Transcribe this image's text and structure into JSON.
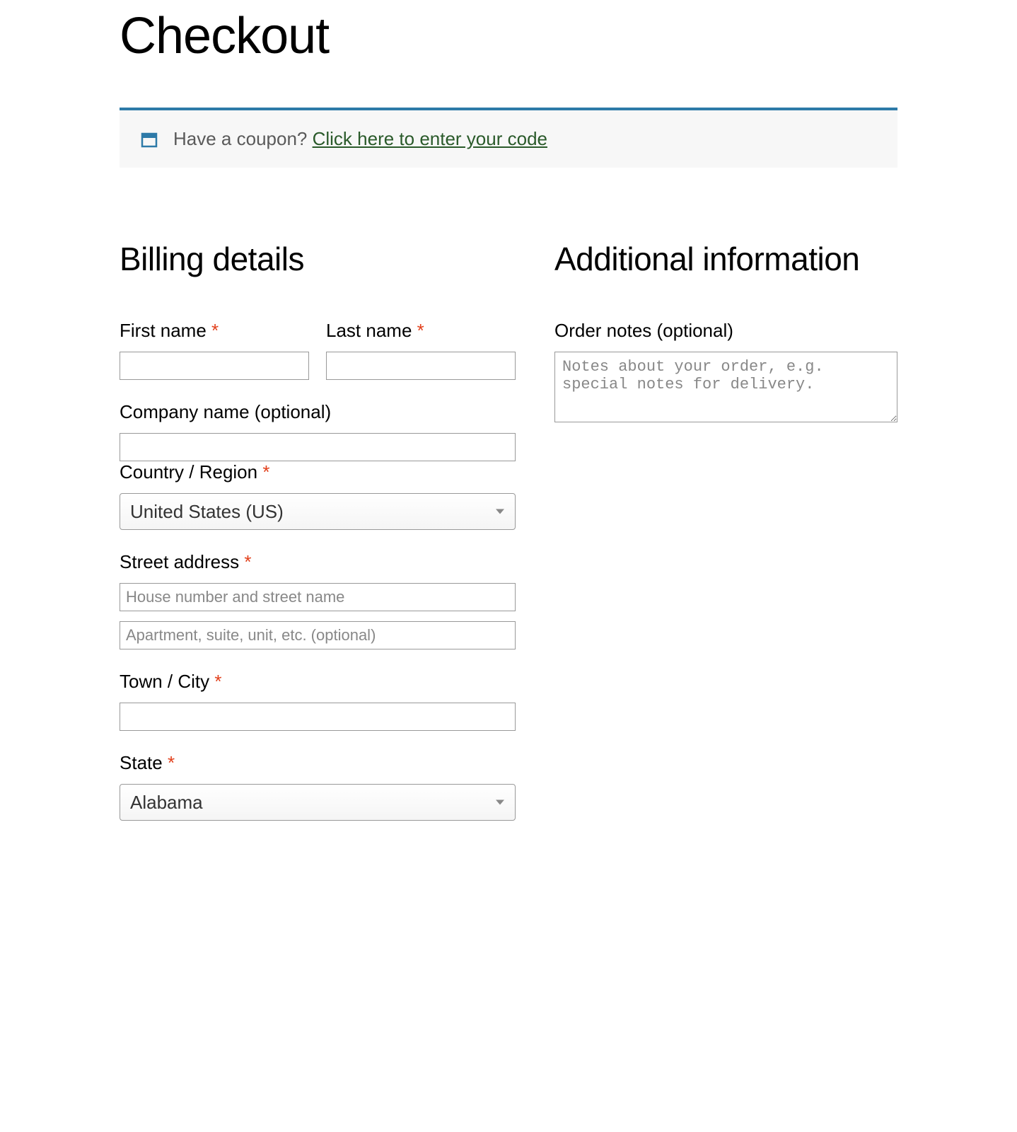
{
  "page": {
    "title": "Checkout"
  },
  "coupon": {
    "prompt": "Have a coupon? ",
    "link_text": "Click here to enter your code"
  },
  "billing": {
    "heading": "Billing details",
    "first_name": {
      "label": "First name ",
      "value": ""
    },
    "last_name": {
      "label": "Last name ",
      "value": ""
    },
    "company": {
      "label": "Company name (optional)",
      "value": ""
    },
    "country": {
      "label": "Country / Region ",
      "selected": "United States (US)"
    },
    "street": {
      "label": "Street address ",
      "line1_placeholder": "House number and street name",
      "line1_value": "",
      "line2_placeholder": "Apartment, suite, unit, etc. (optional)",
      "line2_value": ""
    },
    "city": {
      "label": "Town / City ",
      "value": ""
    },
    "state": {
      "label": "State ",
      "selected": "Alabama"
    }
  },
  "additional": {
    "heading": "Additional information",
    "order_notes": {
      "label": "Order notes (optional)",
      "placeholder": "Notes about your order, e.g. special notes for delivery.",
      "value": ""
    }
  },
  "required_marker": "*"
}
